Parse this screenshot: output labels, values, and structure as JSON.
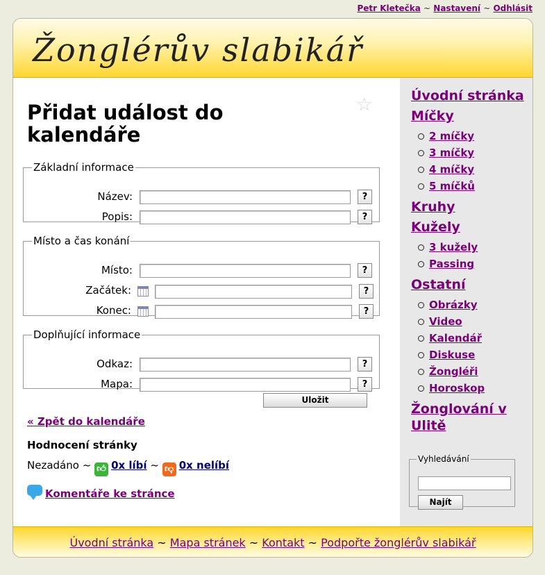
{
  "topbar": {
    "user": "Petr Kletečka",
    "sep": "~",
    "settings": "Nastavení",
    "logout": "Odhlásit"
  },
  "site": {
    "logo": "Žonglérův slabikář"
  },
  "page": {
    "title": "Přidat událost do kalendáře",
    "fieldsets": {
      "basic": {
        "legend": "Základní informace",
        "name_label": "Název:",
        "desc_label": "Popis:"
      },
      "place": {
        "legend": "Místo a čas konání",
        "place_label": "Místo:",
        "start_label": "Začátek:",
        "end_label": "Konec:"
      },
      "extra": {
        "legend": "Doplňující informace",
        "link_label": "Odkaz:",
        "map_label": "Mapa:"
      }
    },
    "help_label": "?",
    "save_label": "Uložit",
    "back_link": "« Zpět do kalendáře",
    "rating": {
      "title": "Hodnocení stránky",
      "status": "Nezadáno",
      "sep": "~",
      "like": "0x líbí",
      "dislike": "0x nelíbí"
    },
    "comments": "Komentáře ke stránce"
  },
  "sidebar": {
    "home": "Úvodní stránka",
    "balls": "Míčky",
    "balls_items": [
      "2 míčky",
      "3 míčky",
      "4 míčky",
      "5 míčků"
    ],
    "rings": "Kruhy",
    "clubs": "Kužely",
    "clubs_items": [
      "3 kužely",
      "Passing"
    ],
    "other": "Ostatní",
    "other_items": [
      "Obrázky",
      "Video",
      "Kalendář",
      "Diskuse",
      "Žongléři",
      "Horoskop"
    ],
    "ulite": "Žonglování v Ulitě",
    "search_legend": "Vyhledávání",
    "search_button": "Najít"
  },
  "footer": {
    "home": "Úvodní stránka",
    "sitemap": "Mapa stránek",
    "contact": "Kontakt",
    "support": "Podpořte žonglérův slabikář",
    "sep": "~"
  }
}
